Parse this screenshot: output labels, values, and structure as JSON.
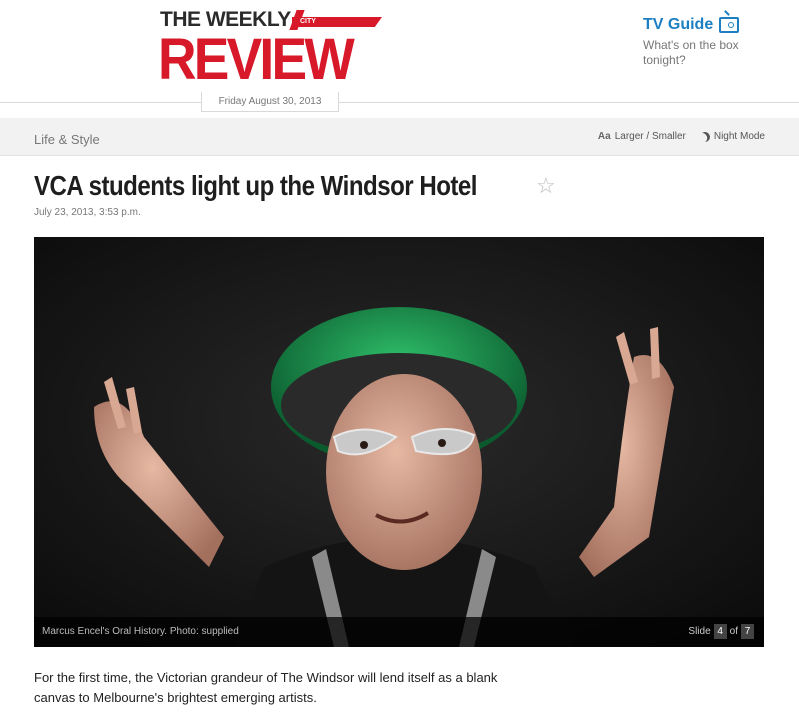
{
  "masthead": {
    "logo_weekly": "THE WEEKLY",
    "logo_city": "CITY",
    "logo_review": "REVIEW",
    "date": "Friday August 30, 2013"
  },
  "tv_guide": {
    "title": "TV Guide",
    "subtitle": "What's on the box tonight?"
  },
  "section_bar": {
    "section": "Life & Style",
    "text_size_icon": "Aa",
    "text_size_label": "Larger / Smaller",
    "night_mode_label": "Night Mode"
  },
  "article": {
    "headline": "VCA students light up the Windsor Hotel",
    "dateline": "July 23, 2013, 3:53 p.m.",
    "lead": "For the first time, the Victorian grandeur of The Windsor will lend itself as a blank canvas to Melbourne's brightest emerging artists."
  },
  "gallery": {
    "caption": "Marcus Encel's Oral History. Photo: supplied",
    "slide_label": "Slide",
    "current": "4",
    "of_label": "of",
    "total": "7"
  },
  "icons": {
    "favourite": "star-icon",
    "tv": "tv-icon",
    "night_mode": "moon-icon"
  },
  "colors": {
    "brand_red": "#d7192a",
    "tv_blue": "#1c7fc2"
  }
}
